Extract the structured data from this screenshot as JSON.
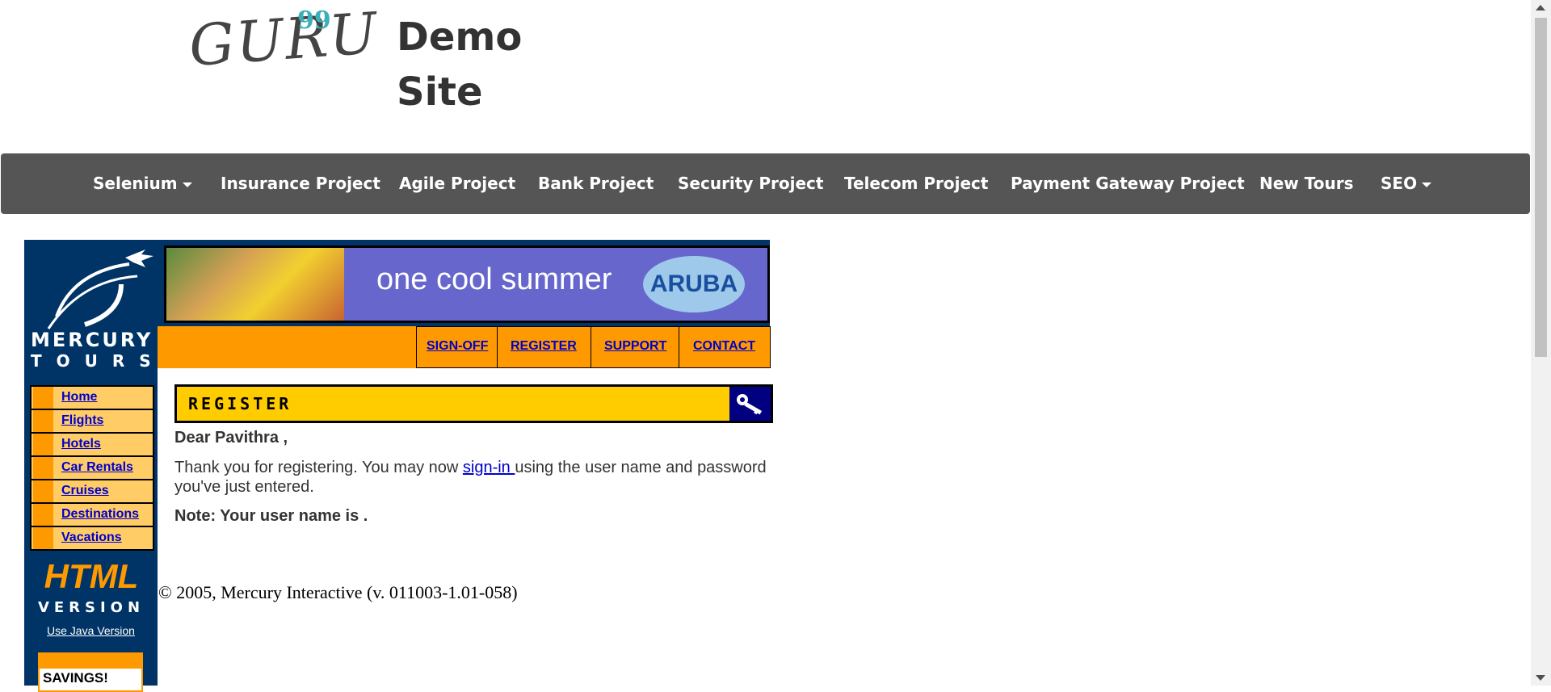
{
  "header": {
    "logo_word": "GURU",
    "logo_number": "99",
    "site_title_line1": "Demo",
    "site_title_line2": "Site"
  },
  "nav": {
    "items": [
      {
        "label": "Selenium",
        "has_dropdown": true
      },
      {
        "label": "Insurance Project",
        "has_dropdown": false
      },
      {
        "label": "Agile Project",
        "has_dropdown": false
      },
      {
        "label": "Bank Project",
        "has_dropdown": false
      },
      {
        "label": "Security Project",
        "has_dropdown": false
      },
      {
        "label": "Telecom Project",
        "has_dropdown": false
      },
      {
        "label": "Payment Gateway Project",
        "has_dropdown": false
      },
      {
        "label": "New Tours",
        "has_dropdown": false
      },
      {
        "label": "SEO",
        "has_dropdown": true
      }
    ]
  },
  "mercury": {
    "logo_line1": "MERCURY",
    "logo_line2": "TOURS",
    "banner_slogan": "one cool summer",
    "banner_brand": "ARUBA",
    "top_links": [
      "SIGN-OFF",
      "REGISTER",
      "SUPPORT",
      "CONTACT"
    ],
    "side_menu": [
      "Home",
      "Flights",
      "Hotels",
      "Car Rentals",
      "Cruises",
      "Destinations",
      "Vacations"
    ],
    "html_version_line1": "HTML",
    "html_version_line2": "VERSION",
    "java_link": "Use Java Version",
    "savings_label": "SAVINGS!",
    "section_title": "REGISTER",
    "greeting": "Dear Pavithra ,",
    "thanks_before": "Thank you for registering. You may now ",
    "signin_link": "sign-in ",
    "thanks_after": "using the user name and password you've just entered.",
    "note": "Note: Your user name is .",
    "copyright": "© 2005, Mercury Interactive (v. 011003-1.01-058)"
  },
  "colors": {
    "nav_bg": "#555555",
    "mercury_navy": "#003366",
    "orange": "#ff9900",
    "register_yellow": "#ffcc00",
    "link_blue": "#0000cc"
  }
}
